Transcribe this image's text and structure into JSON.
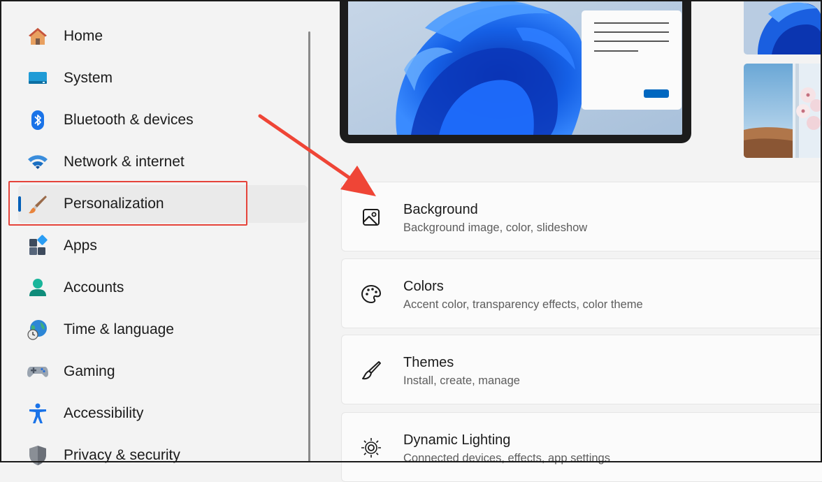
{
  "sidebar": {
    "items": [
      {
        "label": "Home",
        "icon": "home-icon"
      },
      {
        "label": "System",
        "icon": "system-icon"
      },
      {
        "label": "Bluetooth & devices",
        "icon": "bluetooth-icon"
      },
      {
        "label": "Network & internet",
        "icon": "wifi-icon"
      },
      {
        "label": "Personalization",
        "icon": "brush-icon",
        "selected": true
      },
      {
        "label": "Apps",
        "icon": "apps-icon"
      },
      {
        "label": "Accounts",
        "icon": "account-icon"
      },
      {
        "label": "Time & language",
        "icon": "globe-clock-icon"
      },
      {
        "label": "Gaming",
        "icon": "gamepad-icon"
      },
      {
        "label": "Accessibility",
        "icon": "accessibility-icon"
      },
      {
        "label": "Privacy & security",
        "icon": "shield-icon"
      }
    ]
  },
  "cards": [
    {
      "title": "Background",
      "subtitle": "Background image, color, slideshow",
      "icon": "image-icon"
    },
    {
      "title": "Colors",
      "subtitle": "Accent color, transparency effects, color theme",
      "icon": "palette-icon"
    },
    {
      "title": "Themes",
      "subtitle": "Install, create, manage",
      "icon": "brush-icon"
    },
    {
      "title": "Dynamic Lighting",
      "subtitle": "Connected devices, effects, app settings",
      "icon": "lighting-icon"
    }
  ],
  "colors": {
    "accent": "#005fb8",
    "annotation": "#e5433a"
  }
}
